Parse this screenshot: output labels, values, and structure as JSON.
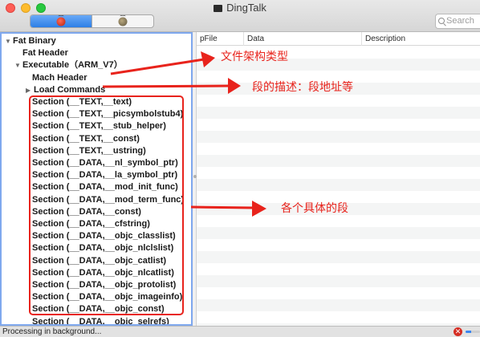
{
  "window": {
    "title": "DingTalk"
  },
  "toolbar": {
    "segments": [
      {
        "icon": "red-bug-icon",
        "active": true
      },
      {
        "icon": "grey-bug-icon",
        "active": false
      }
    ],
    "search_placeholder": "Search"
  },
  "tree": {
    "rows": [
      {
        "label": "Fat Binary",
        "disclosure": "▼"
      },
      {
        "label": "Fat Header",
        "disclosure": ""
      },
      {
        "label": "Executable（ARM_V7）",
        "disclosure": "▼"
      },
      {
        "label": "Mach Header",
        "disclosure": ""
      },
      {
        "label": "Load Commands",
        "disclosure": "▶"
      },
      {
        "label": "Section (__TEXT,__text)",
        "disclosure": ""
      },
      {
        "label": "Section (__TEXT,__picsymbolstub4)",
        "disclosure": ""
      },
      {
        "label": "Section (__TEXT,__stub_helper)",
        "disclosure": ""
      },
      {
        "label": "Section (__TEXT,__const)",
        "disclosure": ""
      },
      {
        "label": "Section (__TEXT,__ustring)",
        "disclosure": ""
      },
      {
        "label": "Section (__DATA,__nl_symbol_ptr)",
        "disclosure": ""
      },
      {
        "label": "Section (__DATA,__la_symbol_ptr)",
        "disclosure": ""
      },
      {
        "label": "Section (__DATA,__mod_init_func)",
        "disclosure": ""
      },
      {
        "label": "Section (__DATA,__mod_term_func)",
        "disclosure": ""
      },
      {
        "label": "Section (__DATA,__const)",
        "disclosure": ""
      },
      {
        "label": "Section (__DATA,__cfstring)",
        "disclosure": ""
      },
      {
        "label": "Section (__DATA,__objc_classlist)",
        "disclosure": ""
      },
      {
        "label": "Section (__DATA,__objc_nlclslist)",
        "disclosure": ""
      },
      {
        "label": "Section (__DATA,__objc_catlist)",
        "disclosure": ""
      },
      {
        "label": "Section (__DATA,__objc_nlcatlist)",
        "disclosure": ""
      },
      {
        "label": "Section (__DATA,__objc_protolist)",
        "disclosure": ""
      },
      {
        "label": "Section (__DATA,__objc_imageinfo)",
        "disclosure": ""
      },
      {
        "label": "Section (__DATA,__objc_const)",
        "disclosure": ""
      },
      {
        "label": "Section (__DATA,__objc_selrefs)",
        "disclosure": ""
      }
    ]
  },
  "table": {
    "columns": [
      "pFile",
      "Data",
      "Description"
    ]
  },
  "status": {
    "text": "Processing in background...",
    "stop_glyph": "✕",
    "progress": 0.4
  },
  "annotations": {
    "label_file_type": "文件架构类型",
    "label_load_commands": "段的描述：段地址等",
    "label_sections": "各个具体的段",
    "color": "#e8231c"
  }
}
